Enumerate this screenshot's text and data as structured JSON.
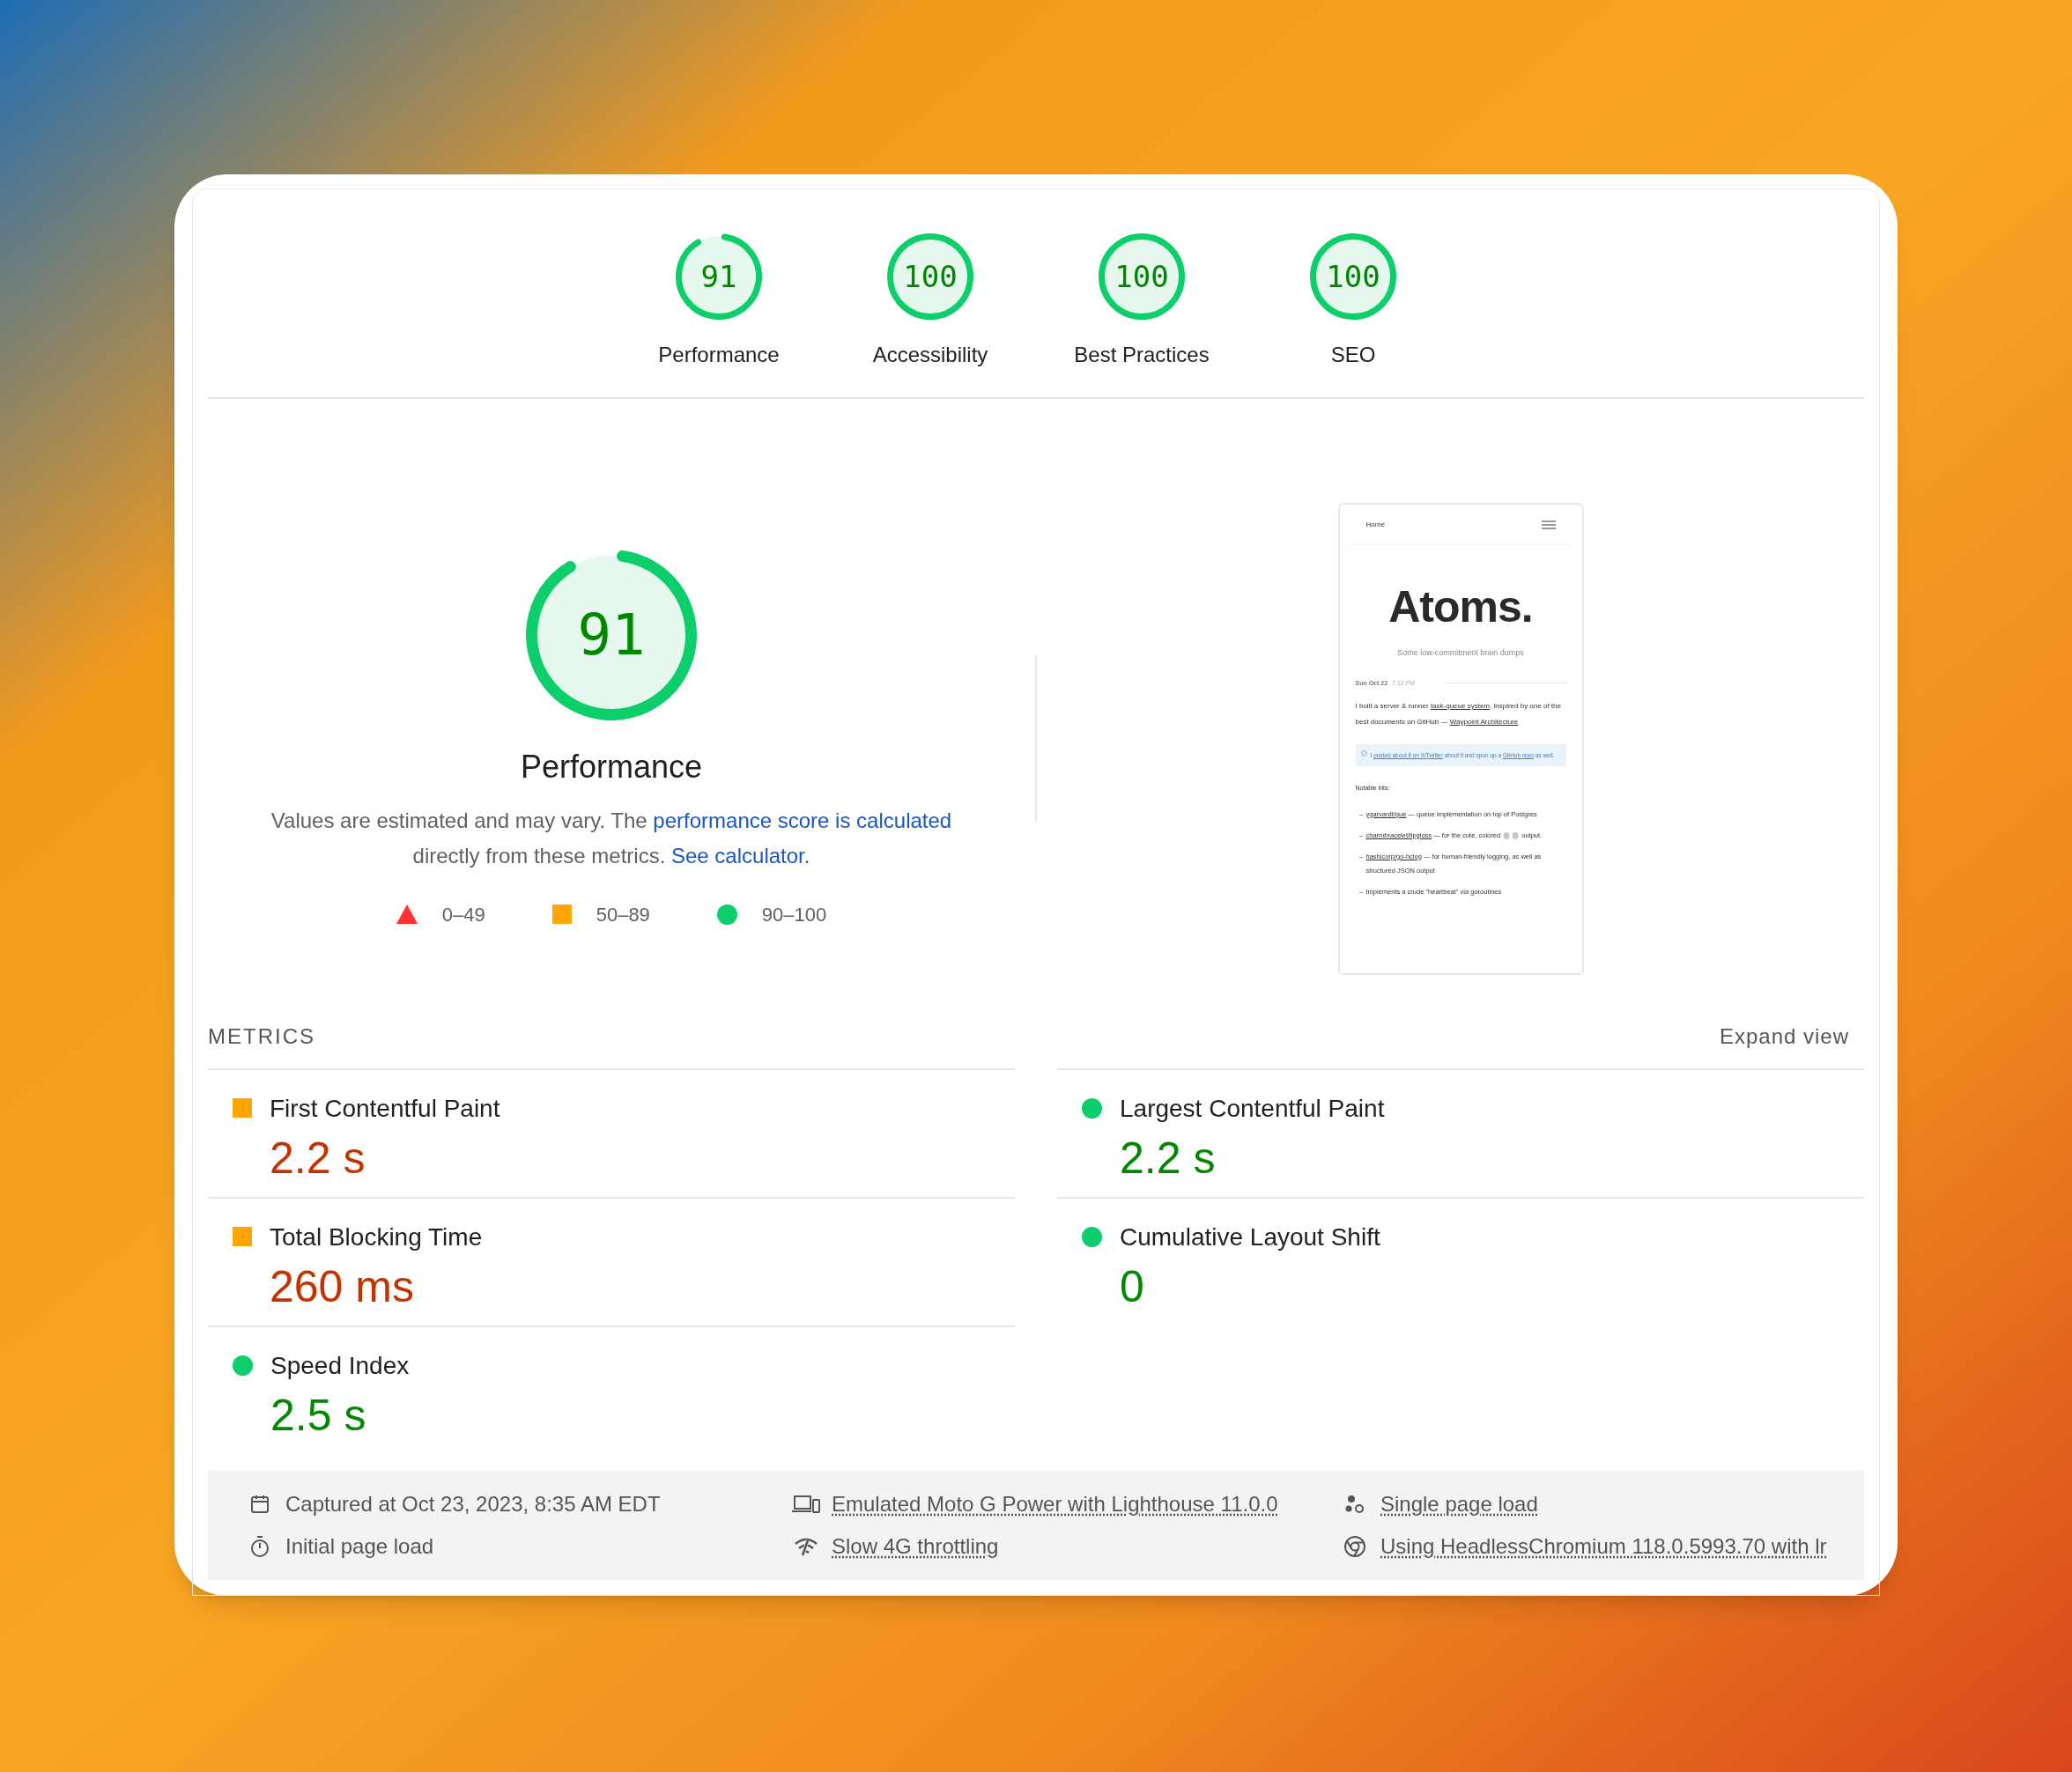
{
  "gauges": [
    {
      "score": "91",
      "label": "Performance",
      "level": 0.91
    },
    {
      "score": "100",
      "label": "Accessibility",
      "level": 1
    },
    {
      "score": "100",
      "label": "Best Practices",
      "level": 1
    },
    {
      "score": "100",
      "label": "SEO",
      "level": 1
    }
  ],
  "performance": {
    "score": "91",
    "level": 0.91,
    "title": "Performance",
    "description": [
      {
        "kind": "text",
        "text": "Values are estimated and may vary. The "
      },
      {
        "kind": "link",
        "text": "performance score is calculated"
      },
      {
        "kind": "text",
        "text": " directly from these metrics. "
      },
      {
        "kind": "link",
        "text": "See calculator."
      }
    ],
    "legend": [
      {
        "kind": "fail",
        "label": "0–49"
      },
      {
        "kind": "average",
        "label": "50–89"
      },
      {
        "kind": "pass",
        "label": "90–100"
      }
    ]
  },
  "screenshot": {
    "nav_label": "Home",
    "title": "Atoms.",
    "subtitle": "Some low-commitment brain dumps",
    "date": "Sun Oct 22",
    "time": "7:12 PM",
    "paragraph": [
      {
        "kind": "text",
        "text": "I built a server & runner "
      },
      {
        "kind": "link",
        "text": "task-queue system"
      },
      {
        "kind": "text",
        "text": ", inspired by one of the best documents on GitHub — "
      },
      {
        "kind": "link",
        "text": "Waypoint Architecture"
      }
    ],
    "callout": [
      {
        "kind": "text",
        "text": "I "
      },
      {
        "kind": "link",
        "text": "posted about it on X/Twitter"
      },
      {
        "kind": "text",
        "text": " about it and spun up a "
      },
      {
        "kind": "link",
        "text": "GitHub repo"
      },
      {
        "kind": "text",
        "text": " as well."
      }
    ],
    "list_heading": "Notable bits:",
    "list": [
      [
        {
          "kind": "link",
          "text": "ygarvardt/gue"
        },
        {
          "kind": "text",
          "text": " — queue implementation on top of Postgres"
        }
      ],
      [
        {
          "kind": "link",
          "text": "charmbracelet/lipgloss"
        },
        {
          "kind": "text",
          "text": " — for the cute, colored "
        },
        {
          "kind": "icon"
        },
        {
          "kind": "icon"
        },
        {
          "kind": "text",
          "text": " output."
        }
      ],
      [
        {
          "kind": "link",
          "text": "hashicorp/go-hclog"
        },
        {
          "kind": "text",
          "text": " — for human-friendly logging, as well as structured JSON output"
        }
      ],
      [
        {
          "kind": "text",
          "text": "Implements a crude \"heartbeat\" via goroutines"
        }
      ]
    ]
  },
  "metrics_heading": "METRICS",
  "expand_label": "Expand view",
  "metrics": [
    {
      "name": "First Contentful Paint",
      "value": "2.2 s",
      "kind": "average"
    },
    {
      "name": "Largest Contentful Paint",
      "value": "2.2 s",
      "kind": "pass"
    },
    {
      "name": "Total Blocking Time",
      "value": "260 ms",
      "kind": "average"
    },
    {
      "name": "Cumulative Layout Shift",
      "value": "0",
      "kind": "pass"
    },
    {
      "name": "Speed Index",
      "value": "2.5 s",
      "kind": "pass"
    }
  ],
  "footer": [
    {
      "kind": "calendar",
      "text": "Captured at Oct 23, 2023, 8:35 AM EDT",
      "link": false
    },
    {
      "kind": "devices",
      "text": "Emulated Moto G Power with Lighthouse 11.0.0",
      "link": true
    },
    {
      "kind": "circles",
      "text": "Single page load",
      "link": true
    },
    {
      "kind": "stopwatch",
      "text": "Initial page load",
      "link": false
    },
    {
      "kind": "signal",
      "text": "Slow 4G throttling",
      "link": true
    },
    {
      "kind": "browser",
      "text": "Using HeadlessChromium 118.0.5993.70 with lr",
      "link": true
    }
  ]
}
